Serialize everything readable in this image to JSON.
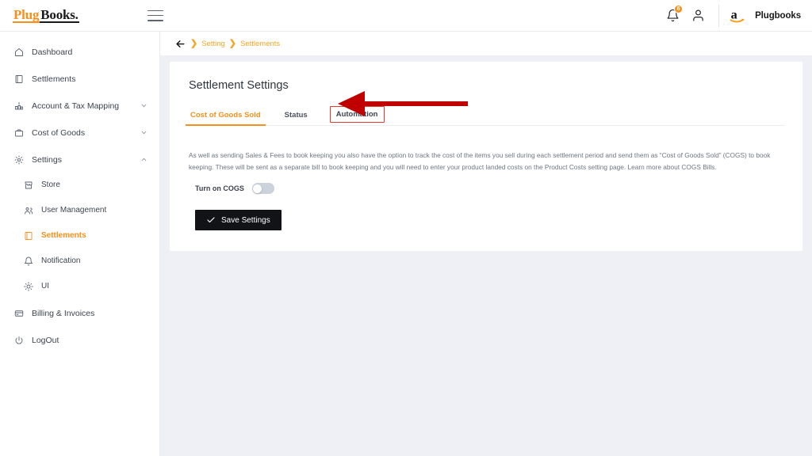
{
  "app": {
    "logo_plug": "Plug",
    "logo_books": "Books.",
    "menu_icon": "hamburger-icon"
  },
  "header": {
    "notification_badge": "6",
    "notification_icon": "bell-icon",
    "account_icon": "person-icon",
    "marketplace_icon": "amazon-logo",
    "marketplace_label": "Plugbooks"
  },
  "sidebar": {
    "items": [
      {
        "label": "Dashboard",
        "icon": "home-icon",
        "level": 0,
        "chevron": "",
        "active": false
      },
      {
        "label": "Settlements",
        "icon": "book-icon",
        "level": 0,
        "chevron": "",
        "active": false
      },
      {
        "label": "Account & Tax Mapping",
        "icon": "bar-chart-icon",
        "level": 0,
        "chevron": "down",
        "active": false
      },
      {
        "label": "Cost of Goods",
        "icon": "briefcase-icon",
        "level": 0,
        "chevron": "down",
        "active": false
      },
      {
        "label": "Settings",
        "icon": "gear-icon",
        "level": 0,
        "chevron": "up",
        "active": false
      },
      {
        "label": "Store",
        "icon": "store-icon",
        "level": 1,
        "chevron": "",
        "active": false
      },
      {
        "label": "User Management",
        "icon": "users-icon",
        "level": 1,
        "chevron": "",
        "active": false
      },
      {
        "label": "Settlements",
        "icon": "book-icon",
        "level": 1,
        "chevron": "",
        "active": true
      },
      {
        "label": "Notification",
        "icon": "bell-icon",
        "level": 1,
        "chevron": "",
        "active": false
      },
      {
        "label": "UI",
        "icon": "sun-icon",
        "level": 1,
        "chevron": "",
        "active": false
      },
      {
        "label": "Billing & Invoices",
        "icon": "card-icon",
        "level": 0,
        "chevron": "",
        "active": false
      },
      {
        "label": "LogOut",
        "icon": "power-icon",
        "level": 0,
        "chevron": "",
        "active": false
      }
    ]
  },
  "breadcrumb": {
    "back_icon": "back-arrow-icon",
    "separator": "❯",
    "items": [
      "Setting",
      "Settlements"
    ]
  },
  "page": {
    "title": "Settlement Settings",
    "tabs": [
      {
        "label": "Cost of Goods Sold",
        "active": true,
        "boxed": false
      },
      {
        "label": "Status",
        "active": false,
        "boxed": false
      },
      {
        "label": "Automation",
        "active": false,
        "boxed": true
      }
    ],
    "description": "As well as sending Sales & Fees to book keeping you also have the option to track the cost of the items you sell during each settlement period and send them as “Cost of Goods Sold” (COGS) to book keeping. These will be sent as a separate bill to book keeping and you will need to enter your product landed costs on the Product Costs setting page. Learn more about COGS Bills.",
    "toggle": {
      "label": "Turn on COGS",
      "state": "off"
    },
    "save_button": {
      "label": "Save Settings",
      "icon": "check-icon"
    }
  },
  "annotation": {
    "type": "arrow",
    "points_to": "Automation",
    "color": "#c00000",
    "highlight_box_color": "#e03b2f"
  },
  "colors": {
    "accent": "#f5901c",
    "breadcrumb": "#f5a623",
    "page_bg": "#eef0f5",
    "card_bg": "#ffffff",
    "button_bg": "#111316",
    "toggle_off": "#ccd2dc"
  }
}
